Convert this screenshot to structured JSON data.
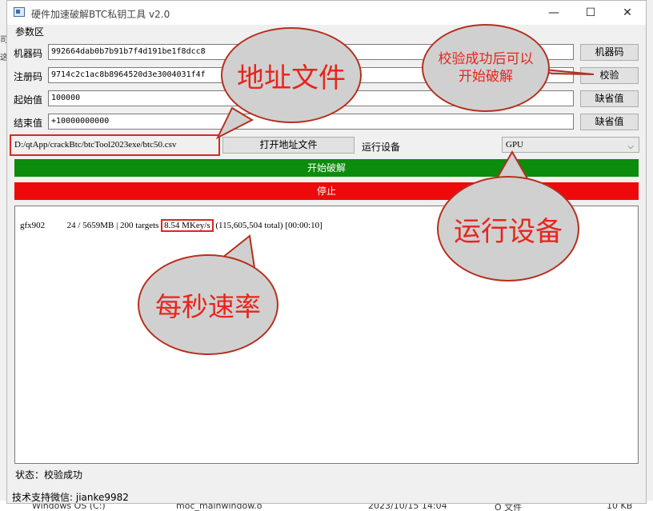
{
  "window": {
    "title": "硬件加速破解BTC私钥工具 v2.0",
    "controls": {
      "minimize": "—",
      "maximize": "☐",
      "close": "✕"
    }
  },
  "params": {
    "group_label": "参数区",
    "machine_code": {
      "label": "机器码",
      "value": "992664dab0b7b91b7f4d191be1f8dcc8",
      "button": "机器码"
    },
    "register_code": {
      "label": "注册码",
      "value": "9714c2c1ac8b8964520d3e3004031f4f",
      "button": "校验"
    },
    "start_value": {
      "label": "起始值",
      "value": "100000",
      "button": "缺省值"
    },
    "end_value": {
      "label": "结束值",
      "value": "+10000000000",
      "button": "缺省值"
    }
  },
  "file": {
    "path": "D:/qtApp/crackBtc/btcTool2023exe/btc50.csv",
    "open_button": "打开地址文件",
    "device_label": "运行设备",
    "device_value": "GPU"
  },
  "actions": {
    "start": "开始破解",
    "stop": "停止"
  },
  "output": {
    "gpu": "gfx902",
    "memory": "24 / 5659MB | 200 targets",
    "speed": "8.54 MKey/s",
    "total": "(115,605,504 total) [00:00:10]"
  },
  "status": "状态：校验成功",
  "support": "技术支持微信: jianke9982",
  "callouts": {
    "verify": "校验成功后可以\n开始破解",
    "address_file": "地址文件",
    "device": "运行设备",
    "speed": "每秒速率"
  },
  "background": {
    "left_chars": [
      "司",
      "这"
    ],
    "drive": "Windows OS (C:)",
    "file": "moc_mainwindow.o",
    "date": "2023/10/15 14:04",
    "type": "O 文件",
    "size": "10 KB"
  },
  "colors": {
    "start": "#0c8c0c",
    "stop": "#ee0a0a",
    "callout_text": "#e8251b",
    "highlight": "#d9291c"
  }
}
